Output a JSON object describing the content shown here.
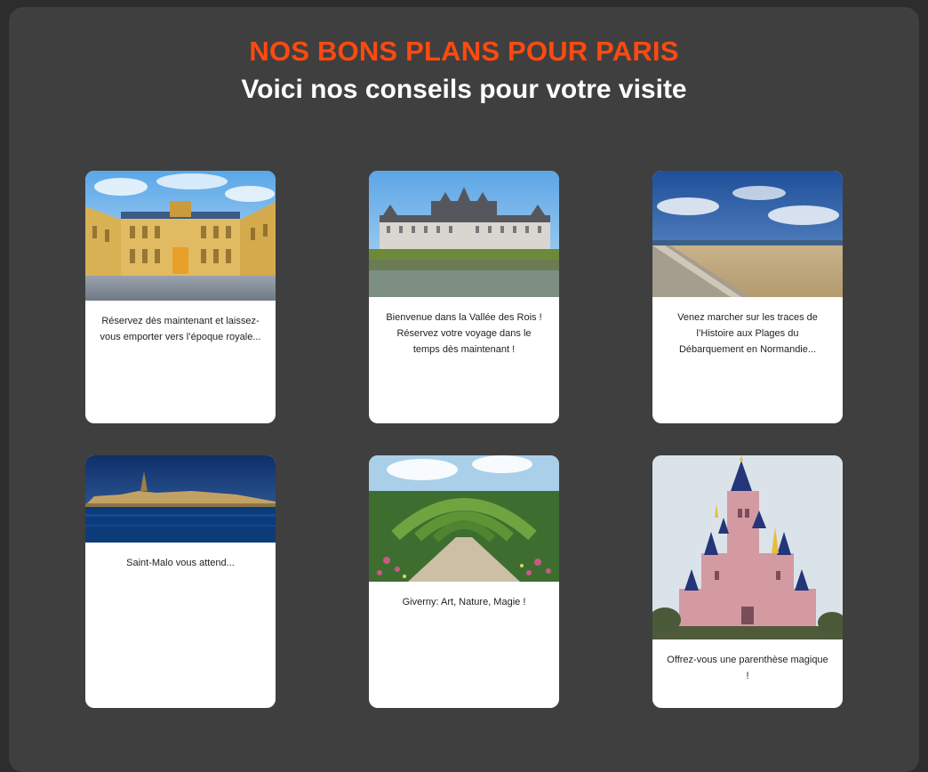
{
  "header": {
    "kicker": "NOS BONS PLANS POUR PARIS",
    "title": "Voici nos conseils pour votre visite"
  },
  "cards": [
    {
      "image": "palace-versailles-photo",
      "text": "Réservez dès maintenant et laissez-vous emporter vers l’époque royale..."
    },
    {
      "image": "chateau-chambord-photo",
      "text": "Bienvenue dans la Vallée des Rois ! Réservez votre voyage dans le temps dès maintenant !"
    },
    {
      "image": "normandy-beach-photo",
      "text": "Venez marcher sur les traces de l’Histoire aux Plages du Débarquement en Normandie..."
    },
    {
      "image": "saint-malo-photo",
      "text": "Saint-Malo vous attend..."
    },
    {
      "image": "giverny-garden-photo",
      "text": "Giverny: Art, Nature, Magie !"
    },
    {
      "image": "disney-castle-photo",
      "text": "Offrez-vous une parenthèse magique !"
    }
  ],
  "colors": {
    "background": "#2d2d2d",
    "panel": "#3f3f3f",
    "accent": "#ff4a0f",
    "title": "#ffffff"
  }
}
